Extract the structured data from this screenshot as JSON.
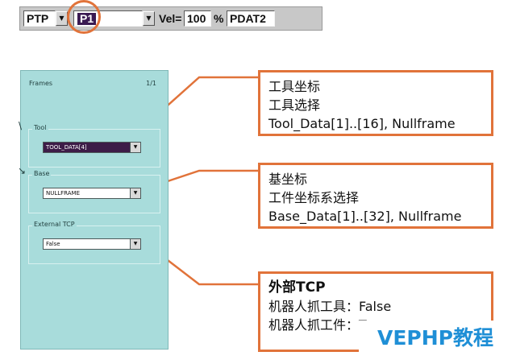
{
  "cmdbar": {
    "motion_type": "PTP",
    "point_name": "P1",
    "vel_label": "Vel=",
    "vel_value": "100",
    "vel_unit": "%",
    "data_name": "PDAT2"
  },
  "frames_panel": {
    "title": "Frames",
    "page": "1/1",
    "tool": {
      "label": "Tool",
      "value": "TOOL_DATA[4]"
    },
    "base": {
      "label": "Base",
      "value": "NULLFRAME"
    },
    "external_tcp": {
      "label": "External TCP",
      "value": "False"
    }
  },
  "callouts": {
    "tool": {
      "line1": "工具坐标",
      "line2": "工具选择",
      "line3": "Tool_Data[1]..[16], Nullframe"
    },
    "base": {
      "line1": "基坐标",
      "line2": "工件坐标系选择",
      "line3": "Base_Data[1]..[32], Nullframe"
    },
    "tcp": {
      "line1": "外部TCP",
      "line2": "机器人抓工具：False",
      "line3": "机器人抓工件：True"
    }
  },
  "watermark": "VEPHP教程",
  "colors": {
    "accent": "#e1733a",
    "panel_bg": "#a8dcdb",
    "selection": "#3a1a52",
    "watermark": "#1f8fd6"
  }
}
